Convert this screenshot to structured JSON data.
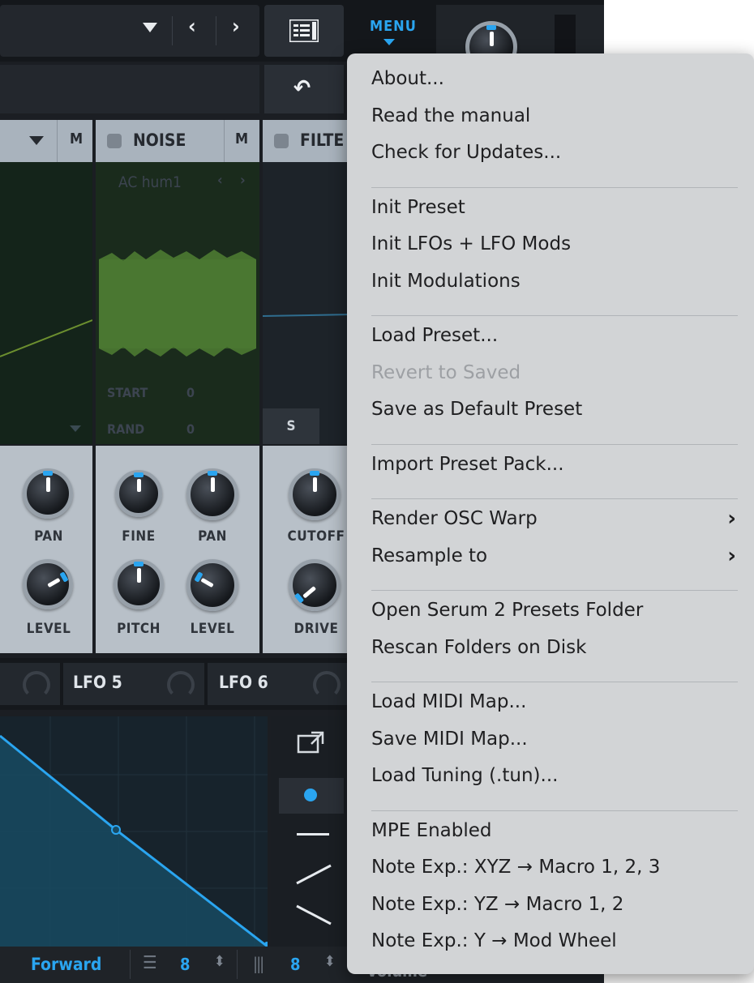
{
  "toolbar": {
    "menu_label": "MENU"
  },
  "oscillators": {
    "osc_partial": {
      "mute_label": "M"
    },
    "noise": {
      "title": "NOISE",
      "mute_label": "M",
      "sample_name": "AC hum1",
      "start_label": "START",
      "start_value": "0",
      "rand_label": "RAND",
      "rand_value": "0"
    },
    "filter": {
      "title": "FILTE",
      "s_label": "S"
    }
  },
  "knobs": {
    "osc_pan": "PAN",
    "osc_level": "LEVEL",
    "noise_fine": "FINE",
    "noise_pan": "PAN",
    "noise_pitch": "PITCH",
    "noise_level": "LEVEL",
    "filter_cutoff": "CUTOFF",
    "filter_drive": "DRIVE"
  },
  "lfo_tabs": [
    "LFO 5",
    "LFO 6"
  ],
  "lfo_footer": {
    "mode": "Forward",
    "grid_x": "8",
    "grid_y": "8",
    "partial_label": "Volume"
  },
  "menu": {
    "groups": [
      [
        {
          "label": "About..."
        },
        {
          "label": "Read the manual"
        },
        {
          "label": "Check for Updates..."
        }
      ],
      [
        {
          "label": "Init Preset"
        },
        {
          "label": "Init LFOs + LFO Mods"
        },
        {
          "label": "Init Modulations"
        }
      ],
      [
        {
          "label": "Load Preset..."
        },
        {
          "label": "Revert to Saved",
          "disabled": true
        },
        {
          "label": "Save as Default Preset"
        }
      ],
      [
        {
          "label": "Import Preset Pack..."
        }
      ],
      [
        {
          "label": "Render OSC Warp",
          "submenu": true
        },
        {
          "label": "Resample to",
          "submenu": true
        }
      ],
      [
        {
          "label": "Open Serum 2 Presets Folder"
        },
        {
          "label": "Rescan Folders on Disk"
        }
      ],
      [
        {
          "label": "Load MIDI Map..."
        },
        {
          "label": "Save MIDI Map..."
        },
        {
          "label": "Load Tuning (.tun)..."
        }
      ],
      [
        {
          "label": "MPE Enabled"
        },
        {
          "label": "Note Exp.: XYZ → Macro 1, 2, 3"
        },
        {
          "label": "Note Exp.: YZ → Macro 1, 2"
        },
        {
          "label": "Note Exp.: Y → Mod Wheel"
        }
      ]
    ]
  },
  "icons": {
    "dropdown": "triangle-down-icon",
    "prev": "chevron-left-icon",
    "next": "chevron-right-icon",
    "preset_browser": "list-icon",
    "undo": "undo-icon",
    "submenu": "chevron-right-icon",
    "popout": "popout-icon"
  },
  "colors": {
    "accent": "#2aa5f0",
    "app_bg": "#1b1e23",
    "menu_bg": "#d2d4d6",
    "panel_header": "#a9b3bd",
    "knob_panel": "#b8c0c8",
    "noise_wave": "#4d7a32"
  }
}
